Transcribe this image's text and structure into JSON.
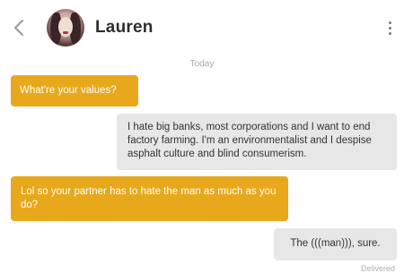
{
  "header": {
    "contact_name": "Lauren",
    "back_icon": "chevron-left-icon",
    "menu_icon": "vertical-dots-icon"
  },
  "conversation": {
    "date_separator": "Today",
    "messages": [
      {
        "direction": "incoming",
        "text": "What're your values?"
      },
      {
        "direction": "outgoing",
        "text": "I hate big banks, most corporations and I want to end factory farming. I'm an environmentalist and I despise asphalt culture and blind consumerism."
      },
      {
        "direction": "incoming",
        "text": "Lol so your partner has to hate the man as much as you do?"
      },
      {
        "direction": "outgoing",
        "text": "The (((man))), sure."
      }
    ],
    "delivery_status": "Delivered"
  },
  "colors": {
    "incoming_bubble": "#e8a81c",
    "outgoing_bubble": "#e7e7e7",
    "incoming_text": "#ffffff",
    "outgoing_text": "#333333"
  }
}
